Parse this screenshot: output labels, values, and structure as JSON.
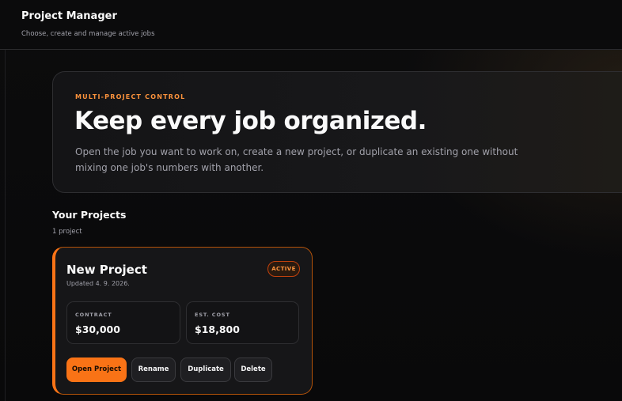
{
  "header": {
    "title": "Project Manager",
    "subtitle": "Choose, create and manage active jobs"
  },
  "hero": {
    "eyebrow": "MULTI-PROJECT CONTROL",
    "title": "Keep every job organized.",
    "description": "Open the job you want to work on, create a new project, or duplicate an existing one without mixing one job's numbers with another."
  },
  "projects": {
    "section_title": "Your Projects",
    "count_label": "1 project",
    "items": [
      {
        "name": "New Project",
        "updated": "Updated 4. 9. 2026.",
        "status": "ACTIVE",
        "contract_label": "CONTRACT",
        "contract_value": "$30,000",
        "cost_label": "EST. COST",
        "cost_value": "$18,800",
        "actions": {
          "open": "Open Project",
          "rename": "Rename",
          "duplicate": "Duplicate",
          "delete": "Delete"
        }
      }
    ]
  },
  "colors": {
    "accent": "#f97316",
    "background": "#0a0a0b"
  }
}
